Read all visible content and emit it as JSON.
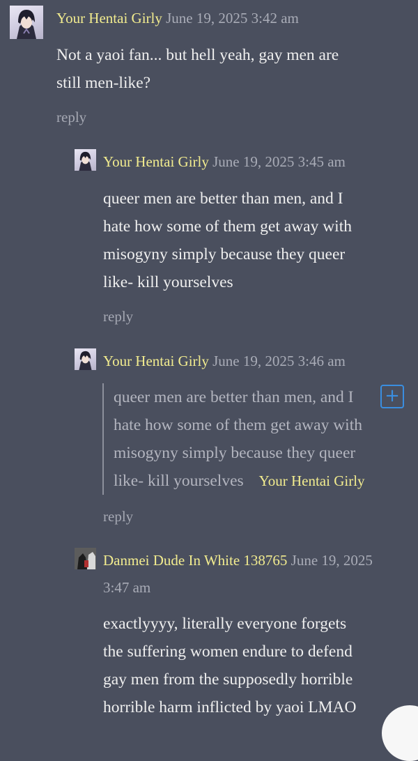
{
  "comments": [
    {
      "author": "Your Hentai Girly",
      "date": "June 19, 2025 3:42 am",
      "lines": [
        "Not a yaoi fan... but hell yeah, gay men are",
        "still men-like?"
      ],
      "reply_label": "reply"
    },
    {
      "author": "Your Hentai Girly",
      "date": "June 19, 2025 3:45 am",
      "lines": [
        "queer men are better than men, and I",
        "hate how some of them get away with",
        "misogyny simply because they queer",
        "like- kill yourselves"
      ],
      "reply_label": "reply"
    },
    {
      "author": "Your Hentai Girly",
      "date": "June 19, 2025 3:46 am",
      "quote": {
        "lines": [
          "queer men are better than men, and I",
          "hate how some of them get away with",
          "misogyny simply because they queer",
          "like- kill yourselves"
        ],
        "author": "Your Hentai Girly"
      },
      "reply_label": "reply"
    },
    {
      "author": "Danmei Dude In White 138765",
      "date_line1": "June 19, 2025",
      "date_line2": "3:47 am",
      "lines": [
        "exactlyyyy, literally everyone forgets",
        "the suffering women endure to defend",
        "gay men from the supposedly horrible",
        "horrible harm inflicted by yaoi LMAO"
      ]
    }
  ],
  "colors": {
    "background": "#4a4f5e",
    "author": "#f2ec8f",
    "date": "#a9acb7",
    "accent": "#3a8ee0"
  },
  "icons": {
    "expand": "plus-icon"
  }
}
